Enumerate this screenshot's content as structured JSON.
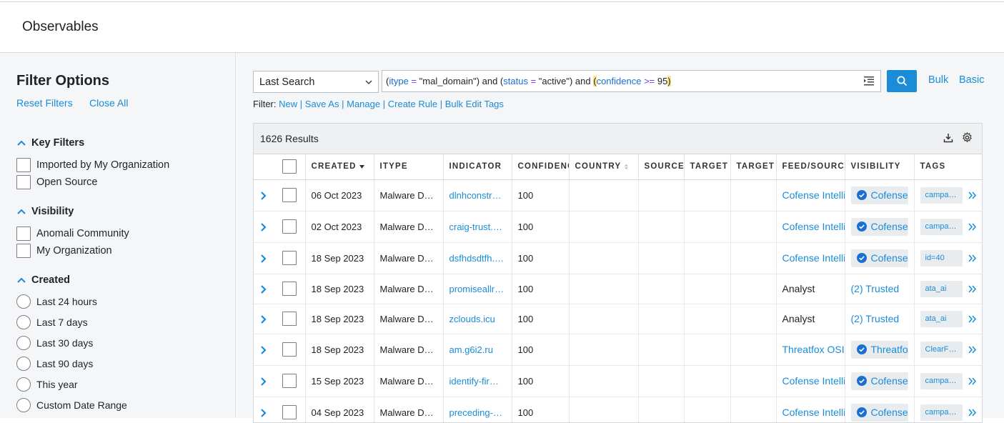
{
  "page": {
    "title": "Observables"
  },
  "sidebar": {
    "title": "Filter Options",
    "reset_filters": "Reset Filters",
    "close_all": "Close All",
    "sections": {
      "key_filters": {
        "title": "Key Filters",
        "options": [
          "Imported by My Organization",
          "Open Source"
        ]
      },
      "visibility": {
        "title": "Visibility",
        "options": [
          "Anomali Community",
          "My Organization"
        ]
      },
      "created": {
        "title": "Created",
        "options": [
          "Last 24 hours",
          "Last 7 days",
          "Last 30 days",
          "Last 90 days",
          "This year",
          "Custom Date Range"
        ]
      }
    }
  },
  "search": {
    "saved_select": "Last Search",
    "query": {
      "p1": "(",
      "f1": "itype",
      "eq1": " = ",
      "v1": "\"mal_domain\"",
      "c1": ") and (",
      "f2": "status",
      "eq2": " = ",
      "v2": "\"active\"",
      "c2": ") and ",
      "open3": "(",
      "f3": "confidence",
      "eq3": " >= ",
      "v3": "95",
      "close3": ")"
    },
    "bulk": "Bulk",
    "basic": "Basic"
  },
  "filter_bar": {
    "label": "Filter:",
    "actions": [
      "New",
      "Save As",
      "Manage",
      "Create Rule",
      "Bulk Edit Tags"
    ]
  },
  "results": {
    "count_label": "1626 Results",
    "columns": [
      "CREATED",
      "ITYPE",
      "INDICATOR",
      "CONFIDENCE",
      "COUNTRY",
      "SOURCE",
      "TARGET",
      "TARGET",
      "FEED/SOURCE",
      "VISIBILITY",
      "TAGS"
    ],
    "rows": [
      {
        "created": "06 Oct 2023",
        "itype": "Malware Domain",
        "indicator": "dlnhconstruction.com",
        "confidence": "100",
        "feed": "Cofense Intelligence",
        "feed_link": true,
        "visibility": "Cofense",
        "vis_pill": true,
        "tag": "campaign"
      },
      {
        "created": "02 Oct 2023",
        "itype": "Malware Domain",
        "indicator": "craig-trust.com",
        "confidence": "100",
        "feed": "Cofense Intelligence",
        "feed_link": true,
        "visibility": "Cofense",
        "vis_pill": true,
        "tag": "campaign"
      },
      {
        "created": "18 Sep 2023",
        "itype": "Malware Domain",
        "indicator": "dsfhdsdtfh.com",
        "confidence": "100",
        "feed": "Cofense Intelligence",
        "feed_link": true,
        "visibility": "Cofense",
        "vis_pill": true,
        "tag": "id=40"
      },
      {
        "created": "18 Sep 2023",
        "itype": "Malware Domain",
        "indicator": "promiseallright.com",
        "confidence": "100",
        "feed": "Analyst",
        "feed_link": false,
        "visibility": "(2) Trusted",
        "vis_pill": false,
        "tag": "ata_ai"
      },
      {
        "created": "18 Sep 2023",
        "itype": "Malware Domain",
        "indicator": "zclouds.icu",
        "confidence": "100",
        "feed": "Analyst",
        "feed_link": false,
        "visibility": "(2) Trusted",
        "vis_pill": false,
        "tag": "ata_ai"
      },
      {
        "created": "18 Sep 2023",
        "itype": "Malware Domain",
        "indicator": "am.g6i2.ru",
        "confidence": "100",
        "feed": "Threatfox OSINT",
        "feed_link": true,
        "visibility": "Threatfox",
        "vis_pill": true,
        "tag": "ClearFake"
      },
      {
        "created": "15 Sep 2023",
        "itype": "Malware Domain",
        "indicator": "identify-firm.com",
        "confidence": "100",
        "feed": "Cofense Intelligence",
        "feed_link": true,
        "visibility": "Cofense",
        "vis_pill": true,
        "tag": "campaign"
      },
      {
        "created": "04 Sep 2023",
        "itype": "Malware Domain",
        "indicator": "preceding-cell.com",
        "confidence": "100",
        "feed": "Cofense Intelligence",
        "feed_link": true,
        "visibility": "Cofense",
        "vis_pill": true,
        "tag": "campaign"
      }
    ]
  },
  "colors": {
    "accent": "#1a8cd8",
    "sidebar_bg": "#f5f6f7",
    "highlight": "#fde68a"
  }
}
